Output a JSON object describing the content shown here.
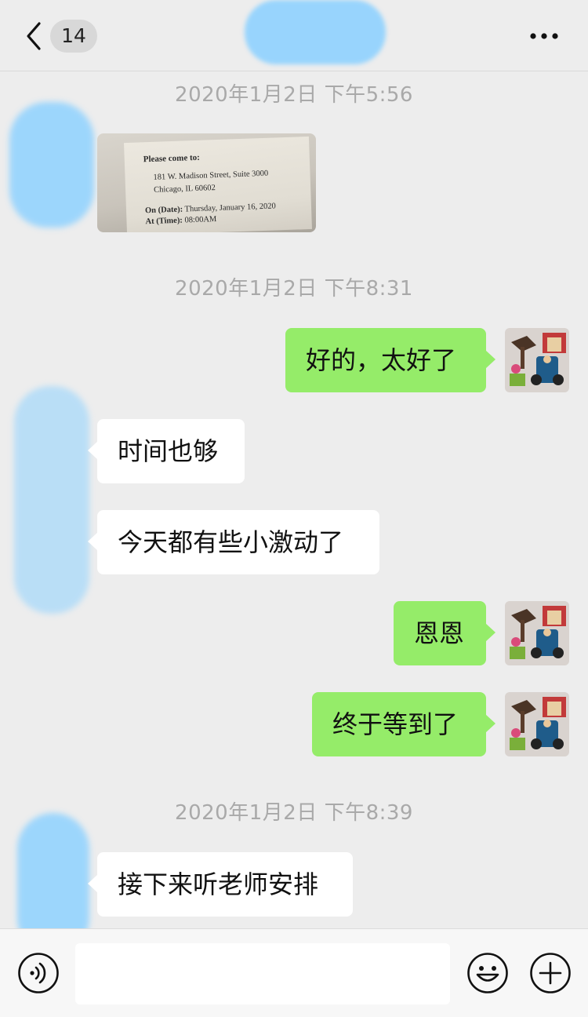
{
  "header": {
    "back_icon": "chevron-left-icon",
    "unread_count": "14",
    "more_icon": "more-dots-icon"
  },
  "timestamps": [
    "2020年1月2日 下午5:56",
    "2020年1月2日 下午8:31",
    "2020年1月2日 下午8:39"
  ],
  "photo_message": {
    "line1": "Please come to:",
    "line2": "181 W. Madison Street, Suite 3000",
    "line3": "Chicago, IL  60602",
    "line4_label": "On (Date):",
    "line4_value": "Thursday, January 16, 2020",
    "line5_label": "At (Time):",
    "line5_value": "08:00AM"
  },
  "messages": [
    {
      "from": "me",
      "text": "好的，太好了"
    },
    {
      "from": "other",
      "text": "时间也够"
    },
    {
      "from": "other",
      "text": "今天都有些小激动了"
    },
    {
      "from": "me",
      "text": "恩恩"
    },
    {
      "from": "me",
      "text": "终于等到了"
    },
    {
      "from": "other",
      "text": "接下来听老师安排"
    }
  ],
  "input_bar": {
    "voice_icon": "voice-icon",
    "input_value": "",
    "emoji_icon": "emoji-icon",
    "plus_icon": "plus-icon"
  },
  "colors": {
    "background": "#ededed",
    "outgoing_bubble": "#95ec69",
    "incoming_bubble": "#ffffff",
    "privacy_blur": "#8fd2ff"
  }
}
